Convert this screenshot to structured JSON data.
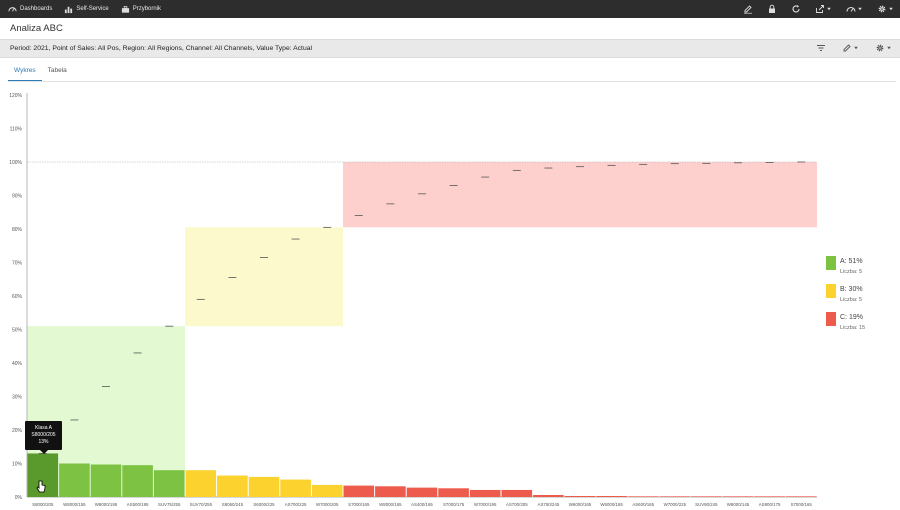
{
  "topbar": {
    "nav": [
      {
        "label": "Dashboards",
        "icon": "gauge-icon"
      },
      {
        "label": "Self-Service",
        "icon": "bar-chart-icon"
      },
      {
        "label": "Przybornik",
        "icon": "toolbox-icon"
      }
    ],
    "tools": [
      "edit-icon",
      "lock-icon",
      "refresh-icon",
      "share-icon",
      "speed-icon",
      "settings-icon"
    ]
  },
  "page": {
    "title": "Analiza ABC"
  },
  "filter": {
    "text": "Period: 2021, Point of Sales: All Pos, Region: All Regions, Channel: All Channels, Value Type: Actual"
  },
  "tabs": [
    {
      "label": "Wykres",
      "active": true
    },
    {
      "label": "Tabela",
      "active": false
    }
  ],
  "colors": {
    "A": "#7dc243",
    "B": "#fbd22e",
    "C": "#ec5b4c",
    "A_bg": "#e2f9d2",
    "B_bg": "#fcf9cc",
    "C_bg": "#fed0cd",
    "A_dark": "#5a9a2c"
  },
  "legend": [
    {
      "key": "A",
      "name": "A: 51%",
      "count": "Liczba: 5"
    },
    {
      "key": "B",
      "name": "B: 30%",
      "count": "Liczba: 5"
    },
    {
      "key": "C",
      "name": "C: 19%",
      "count": "Liczba: 15"
    }
  ],
  "tooltip": {
    "line1": "Klasa A",
    "line2": "S8000/205",
    "line3": "13%"
  },
  "chart_data": {
    "type": "bar",
    "ylim": [
      0,
      120
    ],
    "yticks": [
      "0%",
      "10%",
      "20%",
      "30%",
      "40%",
      "50%",
      "60%",
      "70%",
      "80%",
      "90%",
      "100%",
      "110%",
      "120%"
    ],
    "categories": [
      "S8000/205",
      "W8000/155",
      "W8000/195",
      "AS500/195",
      "SUV75/255",
      "SUV70/255",
      "S8060/245",
      "S6000/225",
      "AS700/225",
      "W7000/205",
      "S7000/165",
      "W8000/165",
      "AS400/165",
      "S7000/175",
      "W7000/195",
      "AS700/205",
      "AS750/245",
      "W6000/165",
      "W6000/165",
      "AS600/165",
      "W7000/225",
      "SUV90/245",
      "W8000/145",
      "AS800/175",
      "S7000/165"
    ],
    "values": [
      13,
      10,
      9.7,
      9.5,
      8,
      8,
      6.4,
      6,
      5.2,
      3.6,
      3.4,
      3.2,
      2.8,
      2.6,
      2.1,
      2.1,
      0.6,
      0.3,
      0.3,
      0.2,
      0.2,
      0.2,
      0.2,
      0.2,
      0.2
    ],
    "cumulative": [
      13,
      23,
      33,
      43,
      51,
      59,
      65.5,
      71.5,
      77,
      80.5,
      84,
      87.5,
      90.5,
      93,
      95.5,
      97.5,
      98.2,
      98.6,
      99,
      99.3,
      99.5,
      99.6,
      99.75,
      99.85,
      100
    ],
    "classes": [
      "A",
      "A",
      "A",
      "A",
      "A",
      "B",
      "B",
      "B",
      "B",
      "B",
      "C",
      "C",
      "C",
      "C",
      "C",
      "C",
      "C",
      "C",
      "C",
      "C",
      "C",
      "C",
      "C",
      "C",
      "C"
    ],
    "class_ranges": [
      {
        "class": "A",
        "y_top": 51
      },
      {
        "class": "B",
        "y_bottom": 51,
        "y_top": 80.5
      },
      {
        "class": "C",
        "y_bottom": 80.5,
        "y_top": 100
      }
    ],
    "reference_line": 100
  }
}
